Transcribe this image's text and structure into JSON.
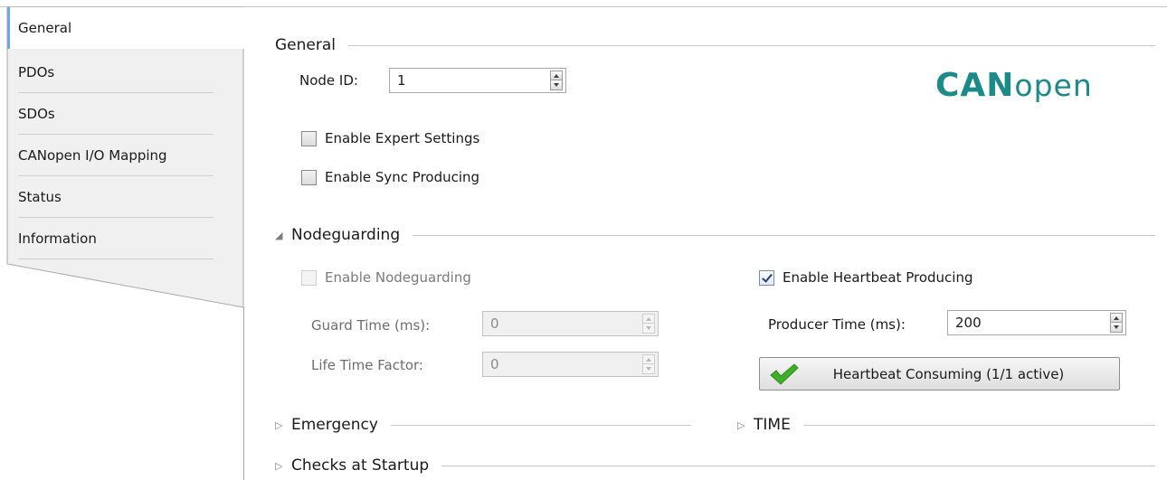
{
  "tabs": [
    {
      "label": "General",
      "active": true
    },
    {
      "label": "PDOs"
    },
    {
      "label": "SDOs"
    },
    {
      "label": "CANopen I/O Mapping"
    },
    {
      "label": "Status"
    },
    {
      "label": "Information"
    }
  ],
  "general": {
    "title": "General",
    "node_id_label": "Node ID:",
    "node_id_value": "1",
    "expert_label": "Enable Expert Settings",
    "expert_checked": false,
    "sync_label": "Enable Sync Producing",
    "sync_checked": false
  },
  "logo": {
    "bold": "CAN",
    "light": "open",
    "color": "#1d8a8a"
  },
  "nodeguarding": {
    "title": "Nodeguarding",
    "enable_label": "Enable Nodeguarding",
    "enable_checked": false,
    "guard_time_label": "Guard Time (ms):",
    "guard_time_value": "0",
    "life_time_label": "Life Time Factor:",
    "life_time_value": "0",
    "heartbeat_label": "Enable Heartbeat Producing",
    "heartbeat_checked": true,
    "producer_time_label": "Producer Time (ms):",
    "producer_time_value": "200",
    "consuming_button": "Heartbeat Consuming (1/1 active)"
  },
  "sections": {
    "emergency": "Emergency",
    "time": "TIME",
    "checks": "Checks at Startup"
  },
  "colors": {
    "tab_accent": "#6aa7e6",
    "check_icon": "#3fae29"
  },
  "icons": {
    "expanded": "triangle-down-icon",
    "collapsed": "triangle-right-icon",
    "ok": "checkmark-icon"
  }
}
